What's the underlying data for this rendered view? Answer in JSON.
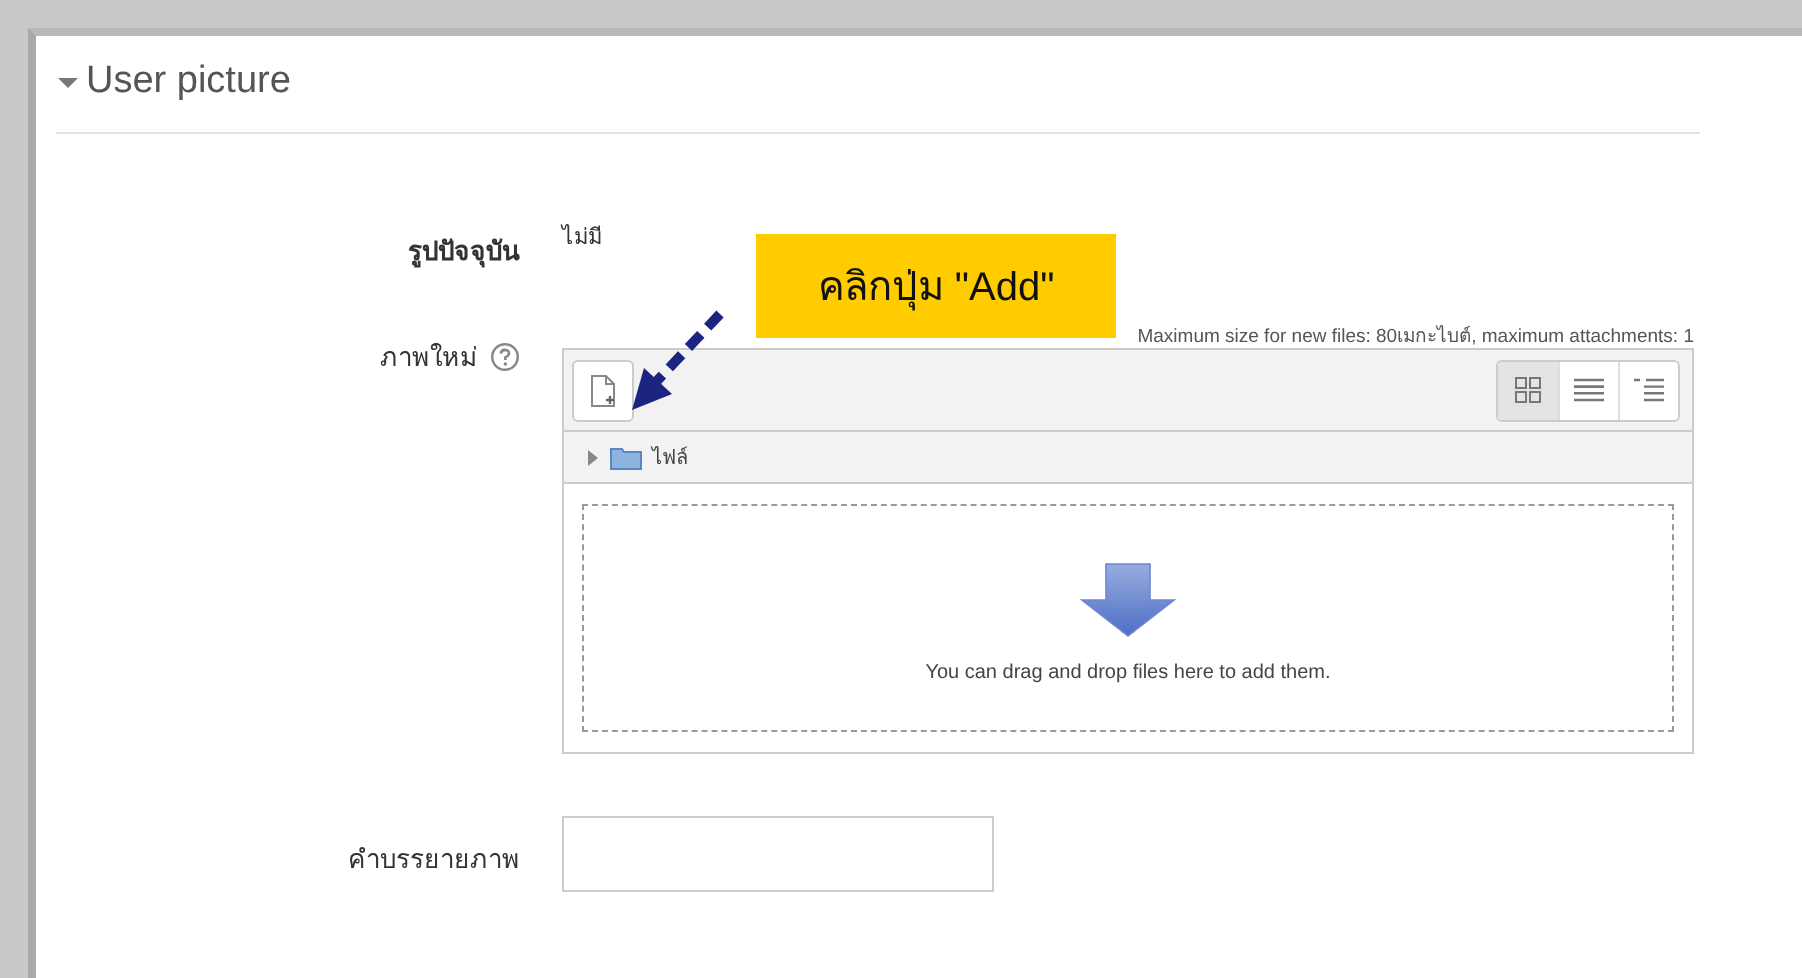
{
  "section": {
    "title": "User picture",
    "expanded": true
  },
  "fields": [
    {
      "kind": "static",
      "label": "รูปปัจจุบัน",
      "value": "ไม่มี"
    },
    {
      "kind": "filepicker",
      "label": "ภาพใหม่",
      "info": "Maximum size for new files: 80เมกะไบต์, maximum attachments: 1",
      "views": [
        {
          "selected": true
        },
        {
          "selected": false
        },
        {
          "selected": false
        }
      ],
      "path": "ไฟล์",
      "dropzone_text": "You can drag and drop files here to add them."
    },
    {
      "kind": "text",
      "label": "คำบรรยายภาพ"
    }
  ],
  "callout": {
    "text": "คลิกปุ่ม \"Add\""
  }
}
